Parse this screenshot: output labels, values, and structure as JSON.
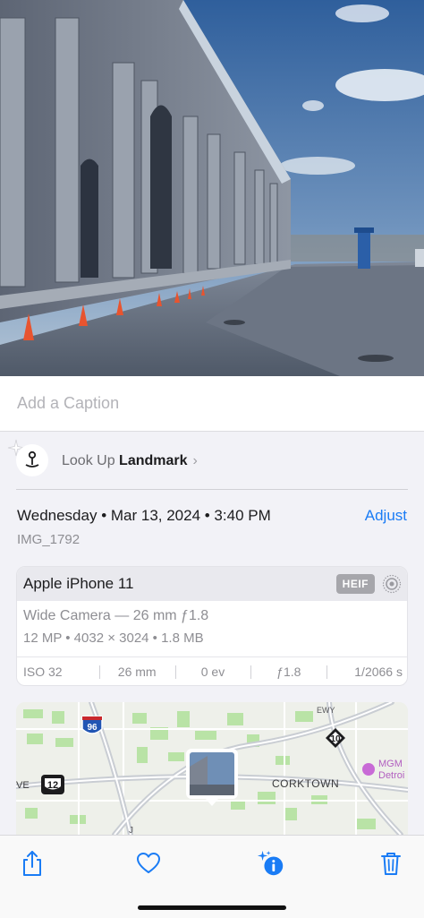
{
  "caption": {
    "placeholder": "Add a Caption"
  },
  "lookup": {
    "prefix": "Look Up",
    "subject": "Landmark",
    "chevron": "›"
  },
  "meta": {
    "date": "Wednesday • Mar 13, 2024 • 3:40 PM",
    "adjust_label": "Adjust",
    "filename": "IMG_1792"
  },
  "camera": {
    "device": "Apple iPhone 11",
    "format_badge": "HEIF",
    "lens": "Wide Camera — 26 mm ƒ1.8",
    "specs": "12 MP • 4032 × 3024 • 1.8 MB",
    "exif": [
      "ISO 32",
      "26 mm",
      "0 ev",
      "ƒ1.8",
      "1/2066 s"
    ]
  },
  "map": {
    "labels": {
      "corktown": "CORKTOWN",
      "mgm1": "MGM",
      "mgm2": "Detroi",
      "street": "EWY",
      "edge": "VE",
      "bottom": "J"
    },
    "shields": {
      "i96": "96",
      "us12": "12",
      "m10": "10"
    }
  },
  "toolbar": {
    "share_icon": "share-icon",
    "favorite_icon": "heart-icon",
    "info_icon": "info-sparkle-icon",
    "delete_icon": "trash-icon"
  },
  "colors": {
    "accent": "#1a7cf5",
    "map_green": "#b9e3a6",
    "map_road": "#c9cdd3"
  }
}
